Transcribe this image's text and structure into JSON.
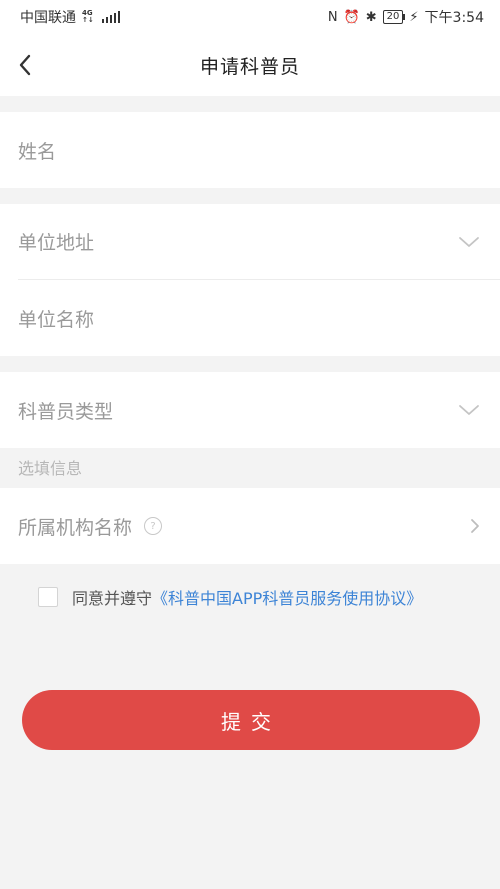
{
  "status_bar": {
    "carrier": "中国联通",
    "net_top": "4G",
    "net_bottom": "↑↓",
    "nfc": "N",
    "alarm": "⏰",
    "bluetooth": "✱",
    "battery": "20",
    "charging": "⚡",
    "time": "下午3:54"
  },
  "navbar": {
    "back_icon": "chevron-left-icon",
    "title": "申请科普员"
  },
  "form": {
    "name_label": "姓名",
    "unit_address_label": "单位地址",
    "unit_name_label": "单位名称",
    "popularizer_type_label": "科普员类型",
    "optional_section_label": "选填信息",
    "org_name_label": "所属机构名称",
    "help_symbol": "?"
  },
  "agreement": {
    "text": "同意并遵守",
    "link": "《科普中国APP科普员服务使用协议》"
  },
  "submit_label": "提交",
  "colors": {
    "accent": "#e04a47",
    "link": "#3d84d6",
    "background": "#f3f3f3"
  }
}
